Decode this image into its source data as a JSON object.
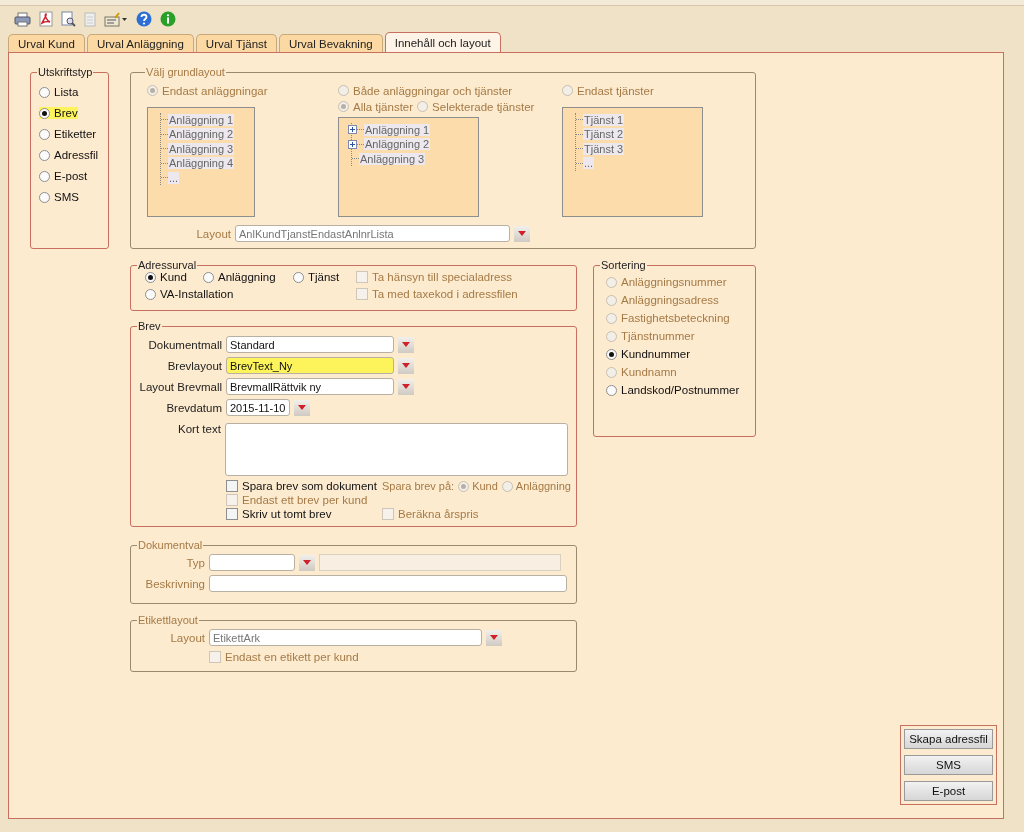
{
  "tabs": [
    {
      "label": "Urval Kund",
      "selected": false
    },
    {
      "label": "Urval Anläggning",
      "selected": false
    },
    {
      "label": "Urval Tjänst",
      "selected": false
    },
    {
      "label": "Urval Bevakning",
      "selected": false
    },
    {
      "label": "Innehåll och layout",
      "selected": true
    }
  ],
  "print_type": {
    "title": "Utskriftstyp",
    "options": [
      {
        "label": "Lista",
        "selected": false,
        "highlighted": false
      },
      {
        "label": "Brev",
        "selected": true,
        "highlighted": true
      },
      {
        "label": "Etiketter",
        "selected": false,
        "highlighted": false
      },
      {
        "label": "Adressfil",
        "selected": false,
        "highlighted": false
      },
      {
        "label": "E-post",
        "selected": false,
        "highlighted": false
      },
      {
        "label": "SMS",
        "selected": false,
        "highlighted": false
      }
    ]
  },
  "base_layout": {
    "title": "Välj grundlayout",
    "disabled": true,
    "columns": [
      {
        "option": {
          "label": "Endast anläggningar",
          "selected": true
        },
        "tree": [
          {
            "label": "Anläggning 1",
            "expandable": false
          },
          {
            "label": "Anläggning 2",
            "expandable": false
          },
          {
            "label": "Anläggning 3",
            "expandable": false
          },
          {
            "label": "Anläggning 4",
            "expandable": false
          },
          {
            "label": "...",
            "expandable": false
          }
        ]
      },
      {
        "option": {
          "label": "Både anläggningar och tjänster",
          "selected": false
        },
        "sub_options": [
          {
            "label": "Alla tjänster",
            "selected": true
          },
          {
            "label": "Selekterade tjänster",
            "selected": false
          }
        ],
        "tree": [
          {
            "label": "Anläggning 1",
            "expandable": true
          },
          {
            "label": "Anläggning 2",
            "expandable": true
          },
          {
            "label": "Anläggning 3",
            "expandable": false
          }
        ]
      },
      {
        "option": {
          "label": "Endast tjänster",
          "selected": false
        },
        "tree": [
          {
            "label": "Tjänst 1",
            "expandable": false
          },
          {
            "label": "Tjänst 2",
            "expandable": false
          },
          {
            "label": "Tjänst 3",
            "expandable": false
          },
          {
            "label": "...",
            "expandable": false
          }
        ]
      }
    ],
    "layout_label": "Layout",
    "layout_value": "AnlKundTjanstEndastAnlnrLista"
  },
  "address": {
    "title": "Adressurval",
    "disabled": false,
    "radios": [
      {
        "label": "Kund",
        "selected": true
      },
      {
        "label": "Anläggning",
        "selected": false
      },
      {
        "label": "Tjänst",
        "selected": false
      },
      {
        "label": "VA-Installation",
        "selected": false
      }
    ],
    "checkboxes": [
      {
        "label": "Ta hänsyn till specialadress",
        "checked": false,
        "disabled": true
      },
      {
        "label": "Ta med taxekod i adressfilen",
        "checked": false,
        "disabled": true
      }
    ]
  },
  "letter": {
    "title": "Brev",
    "disabled": false,
    "fields": [
      {
        "label": "Dokumentmall",
        "value": "Standard",
        "kind": "combo",
        "highlighted": false
      },
      {
        "label": "Brevlayout",
        "value": "BrevText_Ny",
        "kind": "combo",
        "highlighted": true
      },
      {
        "label": "Layout Brevmall",
        "value": "BrevmallRättvik ny",
        "kind": "combo",
        "highlighted": false
      },
      {
        "label": "Brevdatum",
        "value": "2015-11-10",
        "kind": "date",
        "highlighted": false
      }
    ],
    "short_text_label": "Kort text",
    "left_checkboxes": [
      {
        "label": "Spara brev som dokument",
        "checked": false,
        "disabled": false
      },
      {
        "label": "Endast ett brev per kund",
        "checked": false,
        "disabled": true
      },
      {
        "label": "Skriv ut tomt brev",
        "checked": false,
        "disabled": false
      }
    ],
    "save_on": {
      "label": "Spara brev på:",
      "options": [
        {
          "label": "Kund",
          "selected": true
        },
        {
          "label": "Anläggning",
          "selected": false
        }
      ]
    },
    "right_checkbox": {
      "label": "Beräkna årspris",
      "checked": false,
      "disabled": true
    }
  },
  "document": {
    "title": "Dokumentval",
    "disabled": true,
    "type_label": "Typ",
    "description_label": "Beskrivning"
  },
  "label_layout": {
    "title": "Etikettlayout",
    "disabled": true,
    "layout_label": "Layout",
    "layout_value": "EtikettArk",
    "checkbox": {
      "label": "Endast en etikett per kund",
      "checked": false,
      "disabled": true
    }
  },
  "sorting": {
    "title": "Sortering",
    "disabled": false,
    "options": [
      {
        "label": "Anläggningsnummer",
        "selected": false,
        "disabled": true
      },
      {
        "label": "Anläggningsadress",
        "selected": false,
        "disabled": true
      },
      {
        "label": "Fastighetsbeteckning",
        "selected": false,
        "disabled": true
      },
      {
        "label": "Tjänstnummer",
        "selected": false,
        "disabled": true
      },
      {
        "label": "Kundnummer",
        "selected": true,
        "disabled": false
      },
      {
        "label": "Kundnamn",
        "selected": false,
        "disabled": true
      },
      {
        "label": "Landskod/Postnummer",
        "selected": false,
        "disabled": false
      }
    ]
  },
  "actions": [
    "Skapa adressfil",
    "SMS",
    "E-post"
  ]
}
